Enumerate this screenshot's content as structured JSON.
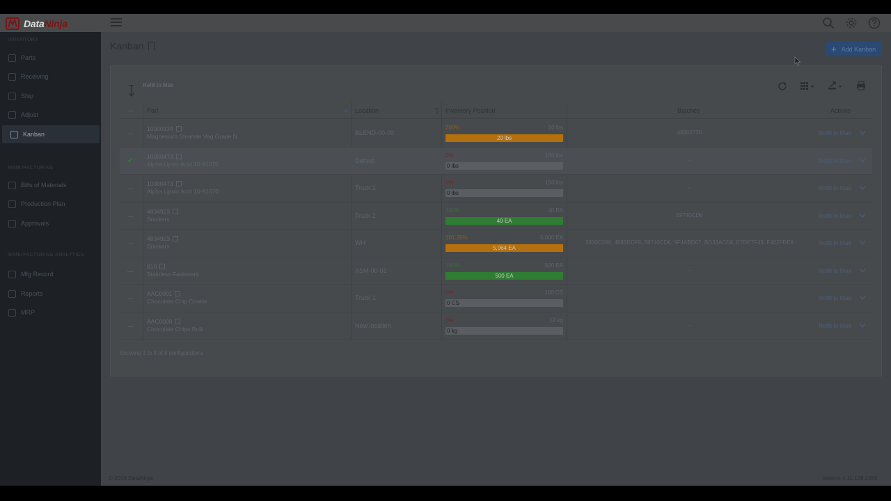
{
  "app": {
    "brand_data": "Data",
    "brand_ninja": "Ninja",
    "footer_copyright": "© 2018 DataNinja",
    "footer_version": "Version 4.11.128.1285"
  },
  "colors": {
    "accent_blue": "#2a4a74",
    "brand_red": "#7a1616",
    "bar_orange": "#b4700c",
    "bar_green": "#2f7d32",
    "bar_empty": "#5a5e62",
    "pct_red": "#7a2222",
    "pct_orange": "#8a5f12",
    "pct_green": "#3c6a3c"
  },
  "sidebar": {
    "sections": [
      {
        "title": "Inventory",
        "items": [
          {
            "label": "Parts",
            "icon": "gears-icon"
          },
          {
            "label": "Receiving",
            "icon": "barcode-icon"
          },
          {
            "label": "Ship",
            "icon": "truck-icon"
          },
          {
            "label": "Adjust",
            "icon": "sliders-icon"
          },
          {
            "label": "Kanban",
            "icon": "layers-icon",
            "active": true
          }
        ]
      },
      {
        "title": "Manufacturing",
        "items": [
          {
            "label": "Bills of Materials",
            "icon": "flask-icon"
          },
          {
            "label": "Production Plan",
            "icon": "calendar-icon"
          },
          {
            "label": "Approvals",
            "icon": "check-icon"
          }
        ]
      },
      {
        "title": "Manufacturing Analytics",
        "items": [
          {
            "label": "Mfg Record",
            "icon": "document-icon"
          },
          {
            "label": "Reports",
            "icon": "table-icon"
          },
          {
            "label": "MRP",
            "icon": "cloud-icon"
          }
        ]
      }
    ]
  },
  "header": {
    "title": "Kanban",
    "add_button": "Add Kanban"
  },
  "toolbar": {
    "refill_label": "Refill to Max"
  },
  "table": {
    "columns": {
      "part": "Part",
      "location": "Location",
      "inventory": "Inventory Position",
      "batches": "Batches",
      "actions": "Actions"
    },
    "rows": [
      {
        "part_number": "10000134",
        "part_name": "Magnesium Stearate Veg Grade N",
        "location": "BLEND-00-00",
        "pct": "200%",
        "pct_level": "over",
        "capacity": "10 lbs",
        "bar_fill": 1.0,
        "bar_label": "20 lbs",
        "bar_kind": "orange",
        "batches": "46803730",
        "action": "Refill to Max",
        "selected": false
      },
      {
        "part_number": "10000473",
        "part_name": "Alpha Lipoic Acid 10-91070",
        "location": "Default",
        "pct": "0%",
        "pct_level": "zero",
        "capacity": "100 lbs",
        "bar_fill": 0.0,
        "bar_label": "0 lbs",
        "bar_kind": "empty",
        "batches": "-",
        "action": "Refill to Max",
        "selected": true
      },
      {
        "part_number": "10000473",
        "part_name": "Alpha Lipoic Acid 10-91070",
        "location": "Truck 1",
        "pct": "0%",
        "pct_level": "zero",
        "capacity": "150 lbs",
        "bar_fill": 0.0,
        "bar_label": "0 lbs",
        "bar_kind": "empty",
        "batches": "-",
        "action": "Refill to Max",
        "selected": false
      },
      {
        "part_number": "4834923",
        "part_name": "Snickers",
        "location": "Truck 2",
        "pct": "100%",
        "pct_level": "full",
        "capacity": "40 EA",
        "bar_fill": 1.0,
        "bar_label": "40 EA",
        "bar_kind": "green",
        "batches": "59740CD6",
        "action": "Refill to Max",
        "selected": false
      },
      {
        "part_number": "4834923",
        "part_name": "Snickers",
        "location": "WH",
        "pct": "101.28%",
        "pct_level": "over",
        "capacity": "5,000 EA",
        "bar_fill": 1.0,
        "bar_label": "5,064 EA",
        "bar_kind": "orange",
        "batches": "3830D268, 4885DDF8, 59740CD6, 9F4ABD07, BD33ACD8, E7DE7F43, F402FDE8",
        "action": "Refill to Max",
        "selected": false
      },
      {
        "part_number": "810",
        "part_name": "Stainless Fasteners",
        "location": "ASM-00-01",
        "pct": "100%",
        "pct_level": "full",
        "capacity": "500 EA",
        "bar_fill": 1.0,
        "bar_label": "500 EA",
        "bar_kind": "green",
        "batches": "-",
        "action": "Refill to Max",
        "selected": false
      },
      {
        "part_number": "AAC0001",
        "part_name": "Chocolate Chip Cookie",
        "location": "Truck 1",
        "pct": "0%",
        "pct_level": "zero",
        "capacity": "100 CS",
        "bar_fill": 0.0,
        "bar_label": "0 CS",
        "bar_kind": "empty",
        "batches": "",
        "action": "Refill to Max",
        "selected": false
      },
      {
        "part_number": "AAC0008",
        "part_name": "Chocolate Chips Bulk",
        "location": "New location",
        "pct": "0%",
        "pct_level": "zero",
        "capacity": "12 kg",
        "bar_fill": 0.0,
        "bar_label": "0 kg",
        "bar_kind": "empty",
        "batches": "-",
        "action": "Refill to Max",
        "selected": false
      }
    ],
    "showing": "Showing 1 to 8 of 8 configurations"
  }
}
